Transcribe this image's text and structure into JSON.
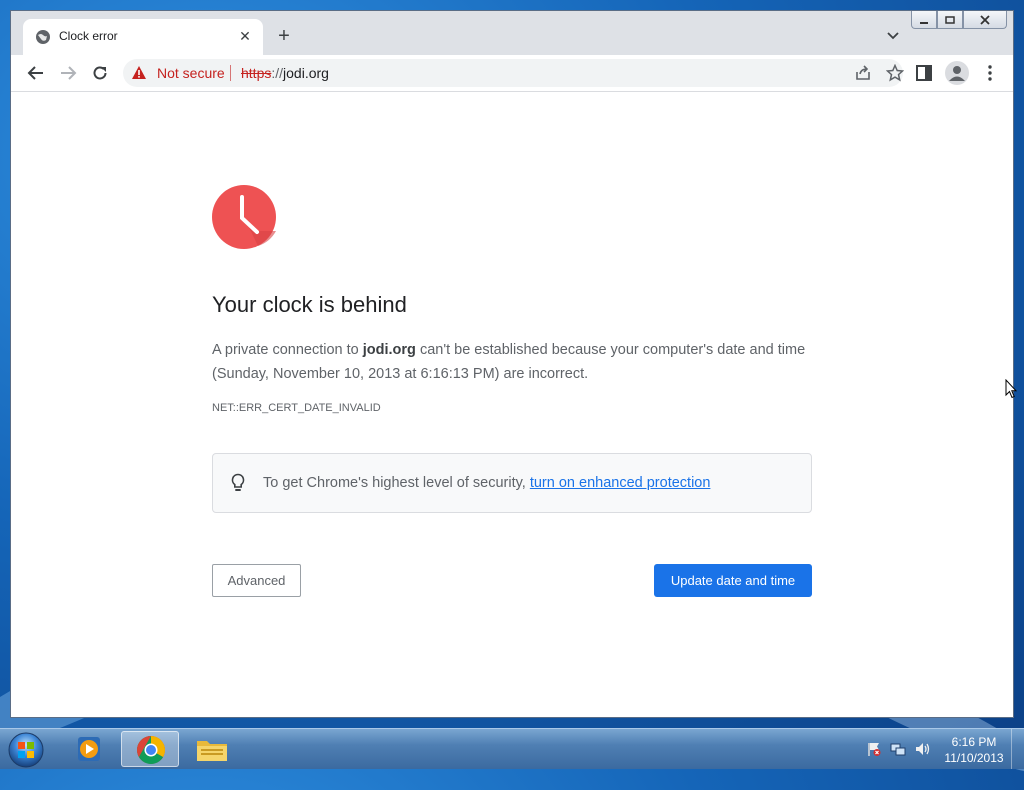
{
  "browser": {
    "tab_title": "Clock error",
    "new_tab_symbol": "+",
    "tab_close_symbol": "✕",
    "security_label": "Not secure",
    "url_scheme": "https",
    "url_separator": "://",
    "url_host": "jodi.org"
  },
  "error_page": {
    "heading": "Your clock is behind",
    "para_prefix": "A private connection to ",
    "para_host": "jodi.org",
    "para_suffix": " can't be established because your computer's date and time (Sunday, November 10, 2013 at 6:16:13 PM) are incorrect.",
    "error_code": "NET::ERR_CERT_DATE_INVALID",
    "security_tip": "To get Chrome's highest level of security, ",
    "security_link": "turn on enhanced protection",
    "advanced_label": "Advanced",
    "update_label": "Update date and time",
    "accent_color": "#1a73e8",
    "error_color": "#ee5253"
  },
  "taskbar": {
    "time": "6:16 PM",
    "date": "11/10/2013"
  },
  "icons": [
    "globe-icon",
    "close-icon",
    "plus-icon",
    "chevron-down-icon",
    "back-icon",
    "forward-icon",
    "reload-icon",
    "warning-icon",
    "share-icon",
    "star-icon",
    "side-panel-icon",
    "profile-icon",
    "menu-icon",
    "clock-icon",
    "lightbulb-icon",
    "windows-start-icon",
    "media-player-icon",
    "chrome-icon",
    "folder-icon",
    "network-icon",
    "speaker-icon",
    "flag-icon"
  ]
}
